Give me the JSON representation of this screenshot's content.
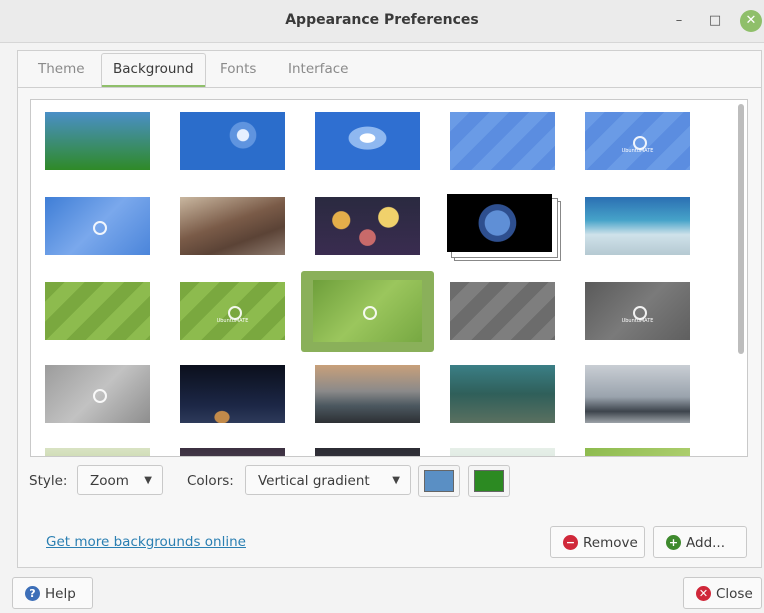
{
  "window": {
    "title": "Appearance Preferences",
    "minimize_glyph": "–",
    "maximize_glyph": "□",
    "close_glyph": "✕"
  },
  "tabs": [
    {
      "label": "Theme"
    },
    {
      "label": "Background"
    },
    {
      "label": "Fonts"
    },
    {
      "label": "Interface"
    }
  ],
  "active_tab": "Background",
  "backgrounds": {
    "selected_index": 12,
    "logo_text": "UbuntuMATE"
  },
  "style": {
    "label": "Style:",
    "value": "Zoom"
  },
  "colors": {
    "label": "Colors:",
    "value": "Vertical gradient",
    "primary": "#5a8fc4",
    "secondary": "#2c8a22"
  },
  "link": {
    "text": "Get more backgrounds online"
  },
  "buttons": {
    "remove": "Remove",
    "add": "Add...",
    "help": "Help",
    "close": "Close"
  },
  "icons": {
    "remove": "remove-icon",
    "add": "add-icon",
    "help": "help-icon",
    "close": "close-icon"
  },
  "accent": "#8fbf6a"
}
